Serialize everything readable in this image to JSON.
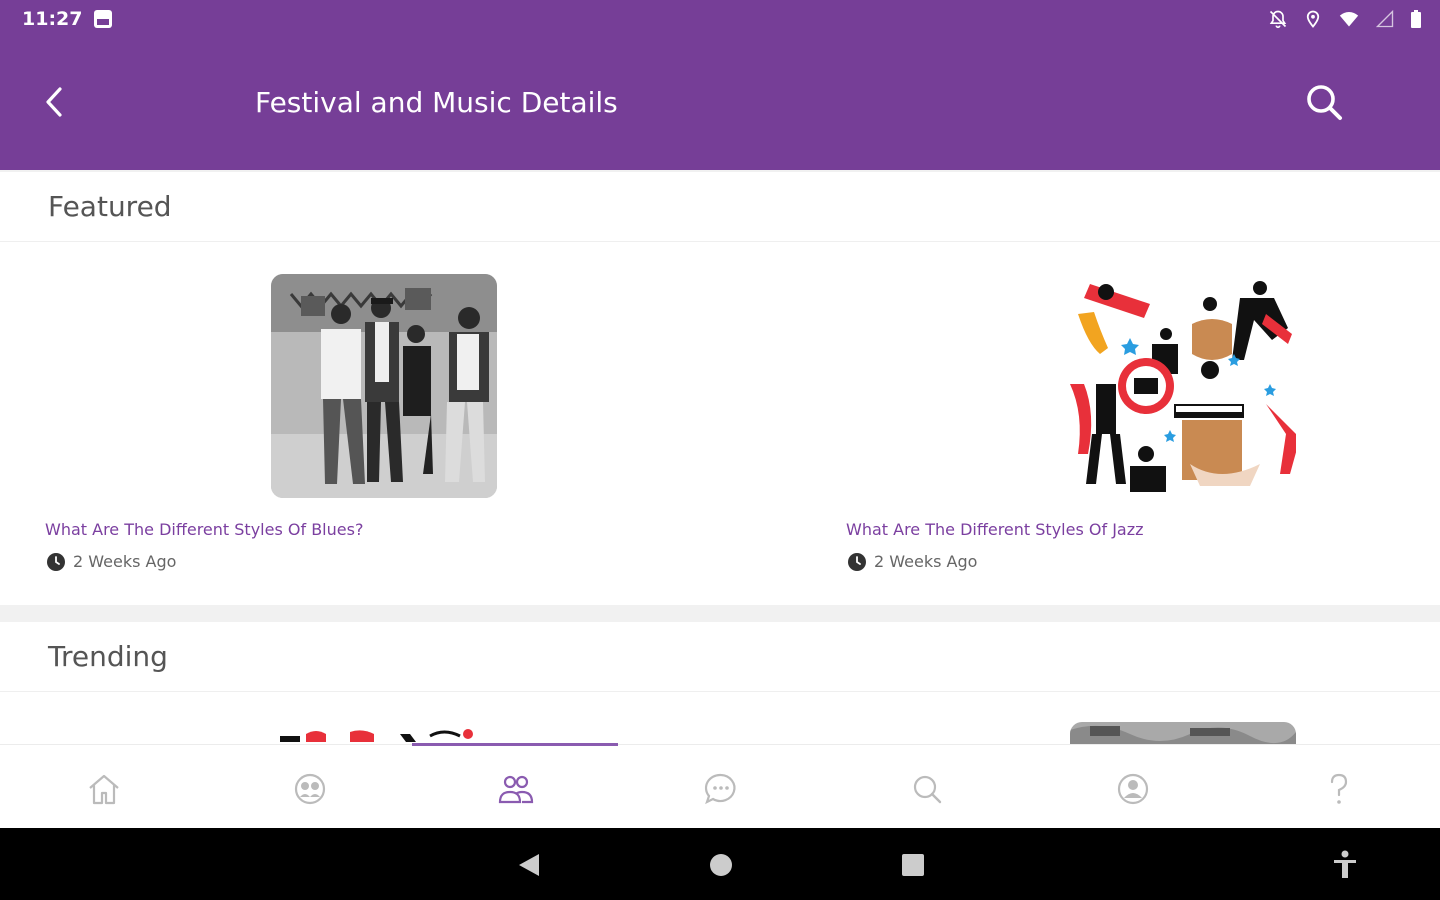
{
  "status_bar": {
    "time": "11:27",
    "icons": [
      "image-icon",
      "notifications-off-icon",
      "location-icon",
      "wifi-icon",
      "signal-icon",
      "battery-icon"
    ]
  },
  "app_bar": {
    "title": "Festival and Music Details",
    "background": "#763e97"
  },
  "featured": {
    "heading": "Featured",
    "items": [
      {
        "title": "What Are The Different Styles Of Blues?",
        "time": "2 Weeks Ago"
      },
      {
        "title": "What Are The Different Styles Of Jazz",
        "time": "2 Weeks Ago"
      }
    ]
  },
  "trending": {
    "heading": "Trending"
  },
  "bottom_nav": {
    "items": [
      "home-icon",
      "group-faces-icon",
      "people-icon",
      "chat-icon",
      "search-icon",
      "profile-icon",
      "help-icon"
    ],
    "active_index": 2,
    "active_color": "#8a5bb0"
  },
  "colors": {
    "accent": "#763e97",
    "link": "#7b3fa0"
  }
}
